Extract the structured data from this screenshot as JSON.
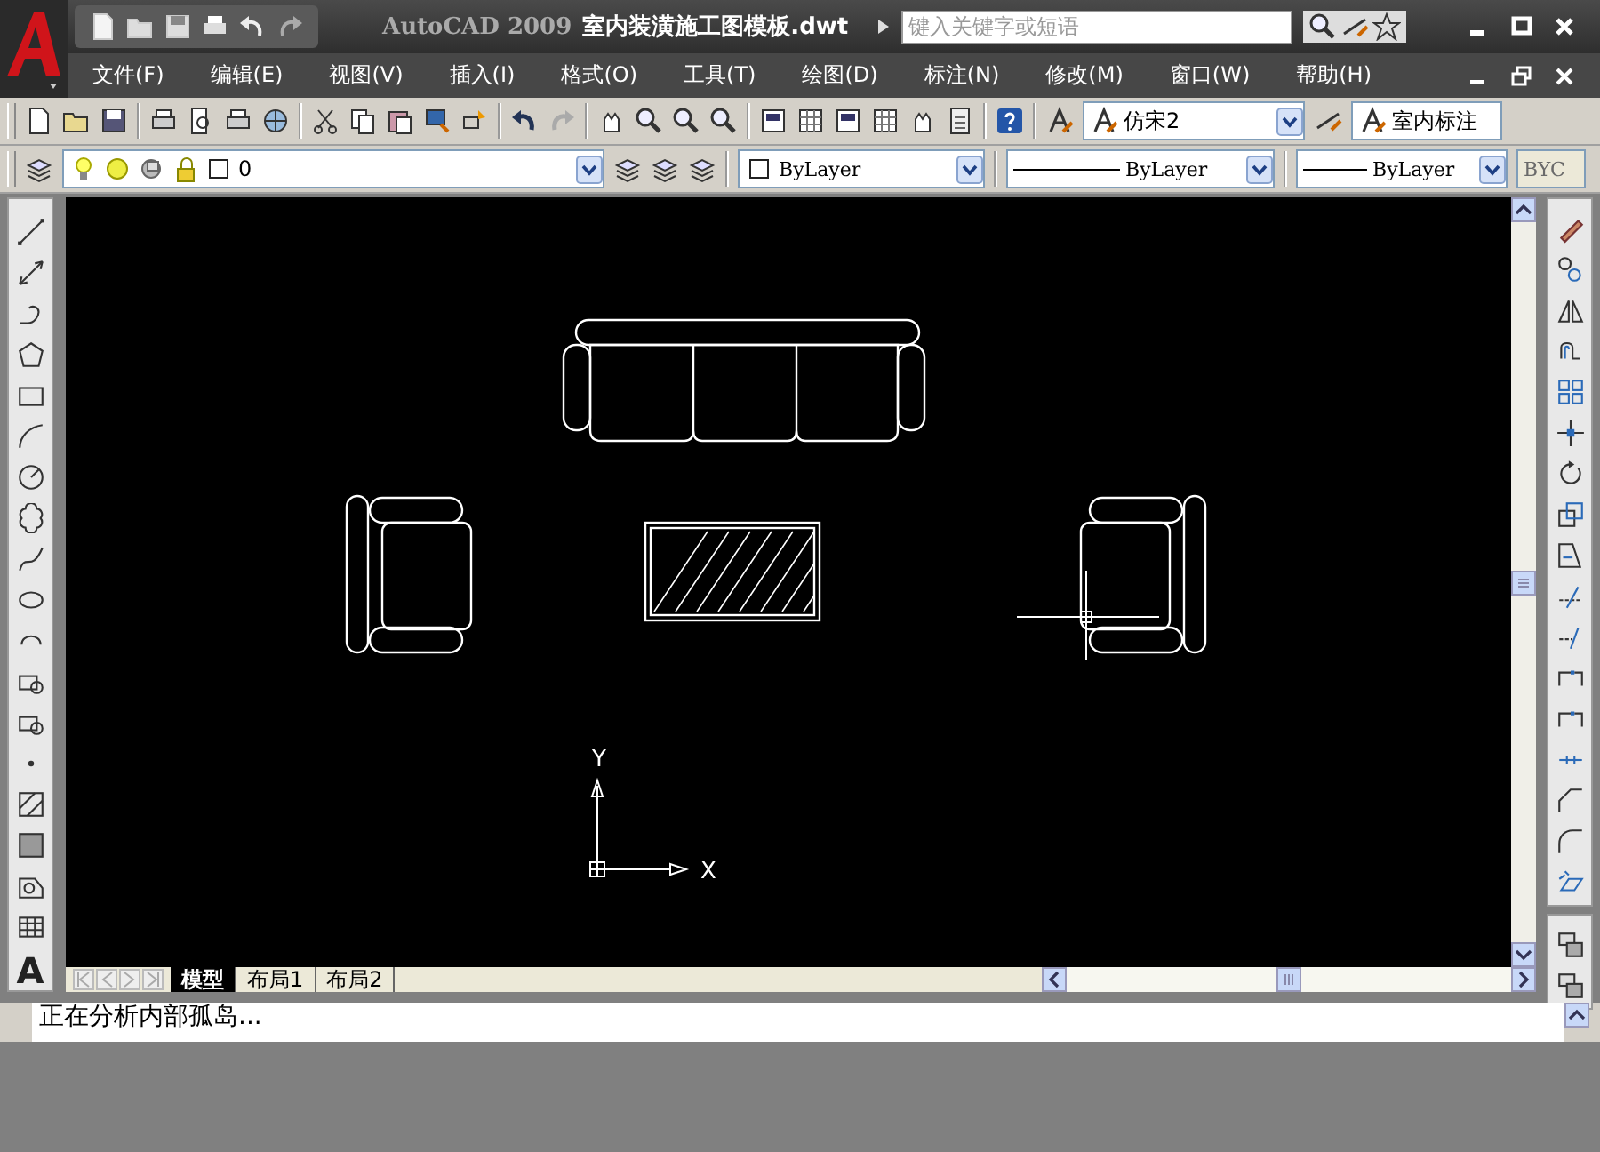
{
  "title_bar": {
    "app_name": "AutoCAD 2009",
    "document": "室内装潢施工图模板.dwt",
    "search": {
      "placeholder": "键入关键字或短语"
    }
  },
  "menu_bar": {
    "items": [
      "文件(F)",
      "编辑(E)",
      "视图(V)",
      "插入(I)",
      "格式(O)",
      "工具(T)",
      "绘图(D)",
      "标注(N)",
      "修改(M)",
      "窗口(W)",
      "帮助(H)"
    ]
  },
  "styles_toolbar": {
    "text_style": "仿宋2",
    "dim_style": "室内标注"
  },
  "layers_toolbar": {
    "layer": "0",
    "color_setting": "ByLayer",
    "linetype": "ByLayer",
    "lineweight": "ByLayer",
    "plot_style": {
      "value": "BYC",
      "disabled": true
    }
  },
  "draw_toolbar": {
    "text_tool_glyph": "A"
  },
  "canvas": {
    "ucs": {
      "x_label": "X",
      "y_label": "Y"
    }
  },
  "layout_tabs": [
    {
      "label": "模型",
      "selected": true
    },
    {
      "label": "布局1",
      "selected": false
    },
    {
      "label": "布局2",
      "selected": false
    }
  ],
  "command_line": {
    "lines": [
      "正在分析内部孤岛..."
    ]
  }
}
